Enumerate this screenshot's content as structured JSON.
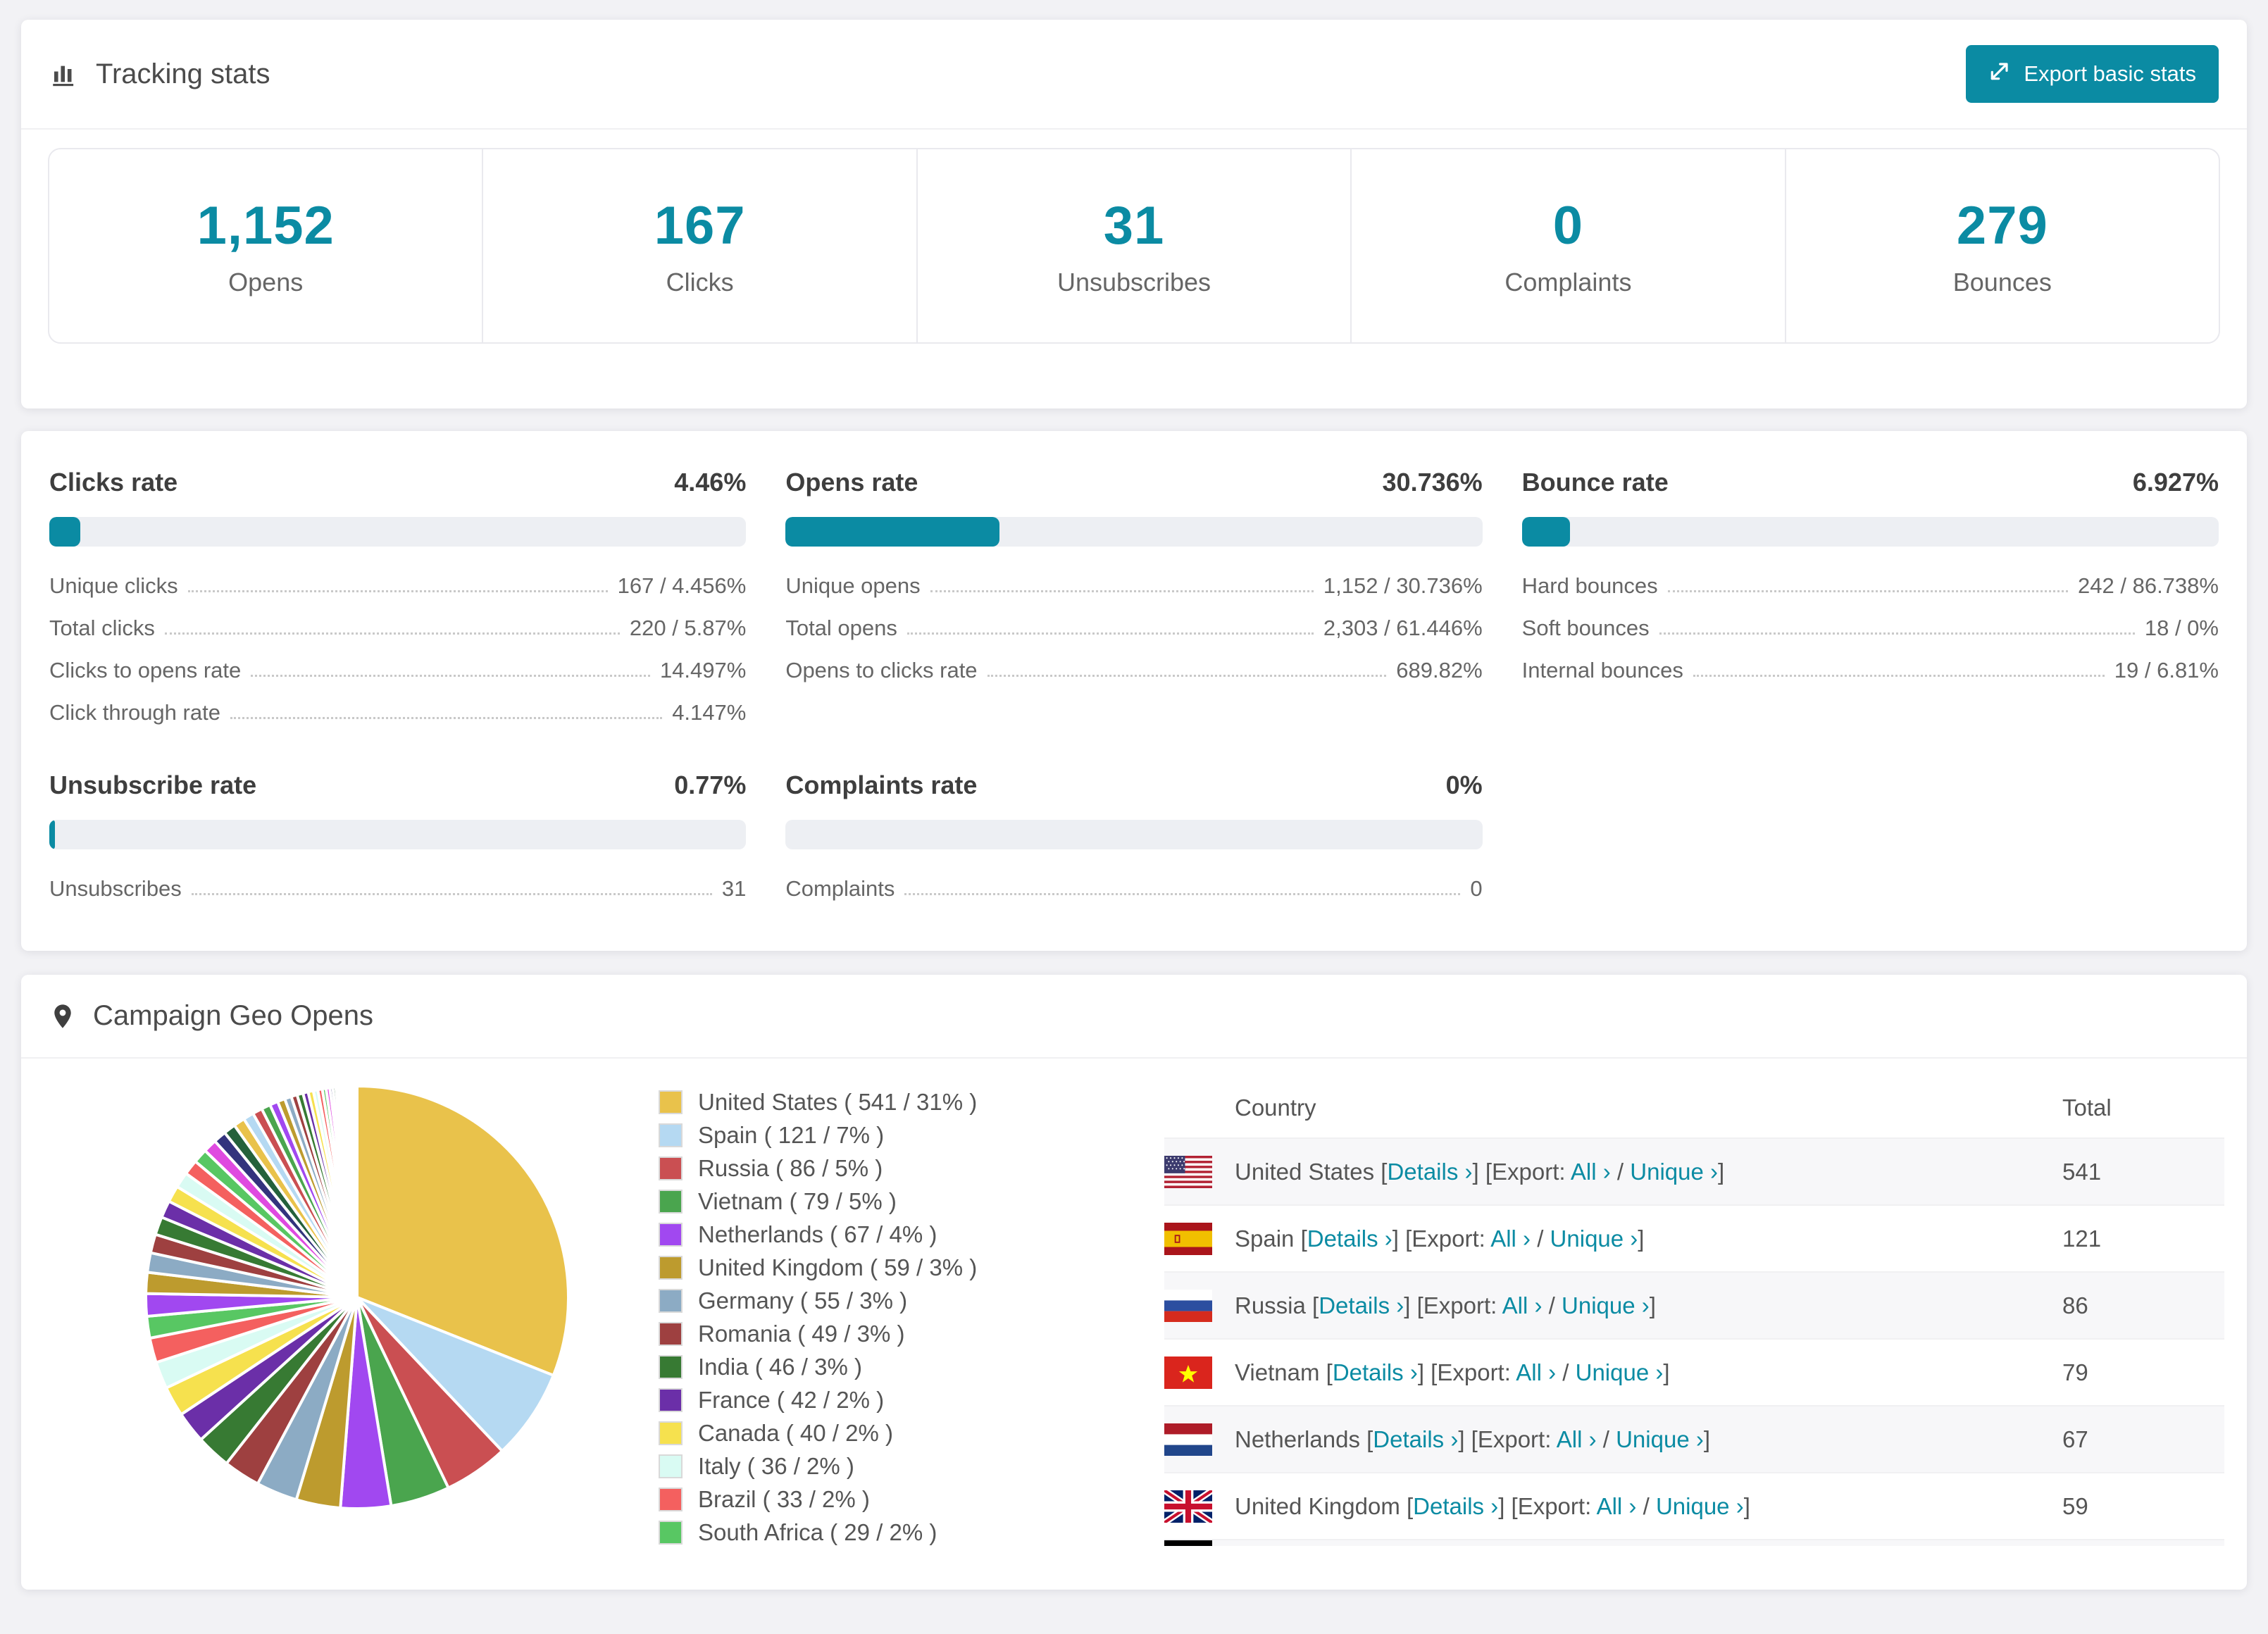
{
  "accent": "#0b8ba3",
  "tracking": {
    "title": "Tracking stats",
    "export_button": "Export basic stats",
    "stats": [
      {
        "value": "1,152",
        "label": "Opens"
      },
      {
        "value": "167",
        "label": "Clicks"
      },
      {
        "value": "31",
        "label": "Unsubscribes"
      },
      {
        "value": "0",
        "label": "Complaints"
      },
      {
        "value": "279",
        "label": "Bounces"
      }
    ]
  },
  "rates": [
    {
      "id": "clicks-rate",
      "title": "Clicks rate",
      "value": "4.46%",
      "pct": 4.46,
      "rows": [
        {
          "label": "Unique clicks",
          "value": "167 / 4.456%"
        },
        {
          "label": "Total clicks",
          "value": "220 / 5.87%"
        },
        {
          "label": "Clicks to opens rate",
          "value": "14.497%"
        },
        {
          "label": "Click through rate",
          "value": "4.147%"
        }
      ]
    },
    {
      "id": "opens-rate",
      "title": "Opens rate",
      "value": "30.736%",
      "pct": 30.736,
      "rows": [
        {
          "label": "Unique opens",
          "value": "1,152 / 30.736%"
        },
        {
          "label": "Total opens",
          "value": "2,303 / 61.446%"
        },
        {
          "label": "Opens to clicks rate",
          "value": "689.82%"
        }
      ]
    },
    {
      "id": "bounce-rate",
      "title": "Bounce rate",
      "value": "6.927%",
      "pct": 6.927,
      "rows": [
        {
          "label": "Hard bounces",
          "value": "242 / 86.738%"
        },
        {
          "label": "Soft bounces",
          "value": "18 / 0%"
        },
        {
          "label": "Internal bounces",
          "value": "19 / 6.81%"
        }
      ]
    },
    {
      "id": "unsubscribe-rate",
      "title": "Unsubscribe rate",
      "value": "0.77%",
      "pct": 0.77,
      "rows": [
        {
          "label": "Unsubscribes",
          "value": "31"
        }
      ]
    },
    {
      "id": "complaints-rate",
      "title": "Complaints rate",
      "value": "0%",
      "pct": 0,
      "rows": [
        {
          "label": "Complaints",
          "value": "0"
        }
      ]
    }
  ],
  "geo": {
    "title": "Campaign Geo Opens",
    "table": {
      "columns": [
        "Country",
        "Total"
      ],
      "link_labels": {
        "details": "Details",
        "export": "Export:",
        "all": "All",
        "unique": "Unique",
        "chevron": "›"
      },
      "rows": [
        {
          "country": "United States",
          "flag": "us",
          "total": "541"
        },
        {
          "country": "Spain",
          "flag": "es",
          "total": "121"
        },
        {
          "country": "Russia",
          "flag": "ru",
          "total": "86"
        },
        {
          "country": "Vietnam",
          "flag": "vn",
          "total": "79"
        },
        {
          "country": "Netherlands",
          "flag": "nl",
          "total": "67"
        },
        {
          "country": "United Kingdom",
          "flag": "gb",
          "total": "59"
        },
        {
          "flag": "de",
          "partial": true
        }
      ]
    },
    "chart_data": {
      "type": "pie",
      "title": "Campaign Geo Opens",
      "legend_position": "right",
      "start_angle_deg": -90,
      "direction": "clockwise",
      "slices": [
        {
          "label": "United States",
          "value": 541,
          "pct": 31,
          "color": "#e9c24b"
        },
        {
          "label": "Spain",
          "value": 121,
          "pct": 7,
          "color": "#b5d9f2"
        },
        {
          "label": "Russia",
          "value": 86,
          "pct": 5,
          "color": "#ca4f52"
        },
        {
          "label": "Vietnam",
          "value": 79,
          "pct": 5,
          "color": "#4aa54e"
        },
        {
          "label": "Netherlands",
          "value": 67,
          "pct": 4,
          "color": "#a148f0"
        },
        {
          "label": "United Kingdom",
          "value": 59,
          "pct": 3,
          "color": "#bd9b2e"
        },
        {
          "label": "Germany",
          "value": 55,
          "pct": 3,
          "color": "#8cabc4"
        },
        {
          "label": "Romania",
          "value": 49,
          "pct": 3,
          "color": "#9e4040"
        },
        {
          "label": "India",
          "value": 46,
          "pct": 3,
          "color": "#377a33"
        },
        {
          "label": "France",
          "value": 42,
          "pct": 2,
          "color": "#6b2fa8"
        },
        {
          "label": "Canada",
          "value": 40,
          "pct": 2,
          "color": "#f6e14e"
        },
        {
          "label": "Italy",
          "value": 36,
          "pct": 2,
          "color": "#d9fbf3"
        },
        {
          "label": "Brazil",
          "value": 33,
          "pct": 2,
          "color": "#f4605f"
        },
        {
          "label": "South Africa",
          "value": 29,
          "pct": 2,
          "color": "#58c763"
        }
      ],
      "other_slices_values_approx": [
        30,
        28,
        26,
        25,
        24,
        23,
        22,
        21,
        20,
        19,
        18,
        17,
        16,
        15,
        14,
        13,
        12,
        11,
        10,
        9,
        8,
        8,
        7,
        7,
        6,
        6,
        5,
        5,
        4,
        4,
        3,
        3,
        3,
        2,
        2,
        2,
        2,
        1,
        1,
        1,
        1,
        1,
        1,
        1,
        1,
        1,
        1,
        1
      ],
      "extra_cycle_colors": [
        "#df4ae0",
        "#33337d",
        "#24613b"
      ]
    }
  }
}
